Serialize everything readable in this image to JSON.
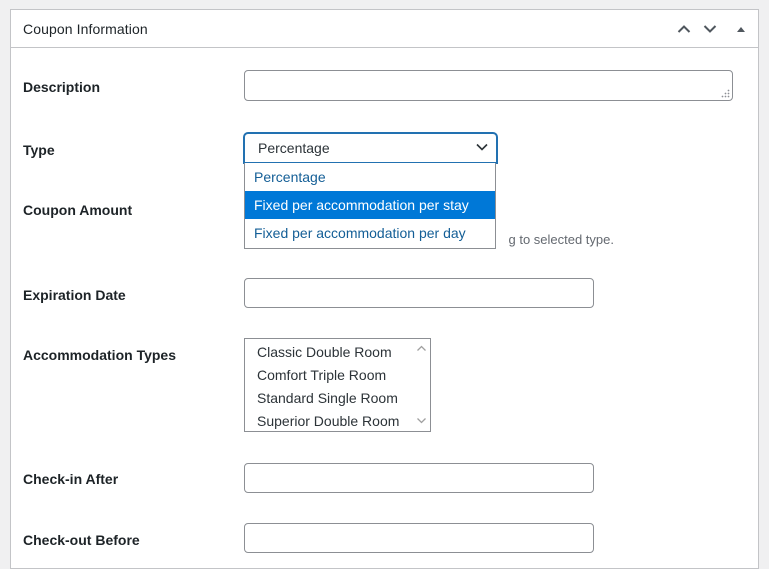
{
  "metabox": {
    "title": "Coupon Information",
    "controls": {
      "move_up_icon": "chevron-up-icon",
      "move_down_icon": "chevron-down-icon",
      "toggle_icon": "triangle-up-icon"
    }
  },
  "fields": {
    "description": {
      "label": "Description",
      "value": ""
    },
    "type": {
      "label": "Type",
      "selected": "Percentage",
      "options": [
        "Percentage",
        "Fixed per accommodation per stay",
        "Fixed per accommodation per day"
      ],
      "highlighted_index": 1
    },
    "coupon_amount": {
      "label": "Coupon Amount",
      "hint": "Enter percent or fixed amount according to selected type.",
      "hint_visible": "g to selected type."
    },
    "expiration_date": {
      "label": "Expiration Date",
      "value": ""
    },
    "accommodation_types": {
      "label": "Accommodation Types",
      "options": [
        "Classic Double Room",
        "Comfort Triple Room",
        "Standard Single Room",
        "Superior Double Room"
      ]
    },
    "check_in_after": {
      "label": "Check-in After",
      "value": ""
    },
    "check_out_before": {
      "label": "Check-out Before",
      "value": ""
    }
  },
  "colors": {
    "accent": "#2271b1",
    "highlight": "#0078d7",
    "option_text": "#135e96",
    "border": "#8c8f94"
  }
}
